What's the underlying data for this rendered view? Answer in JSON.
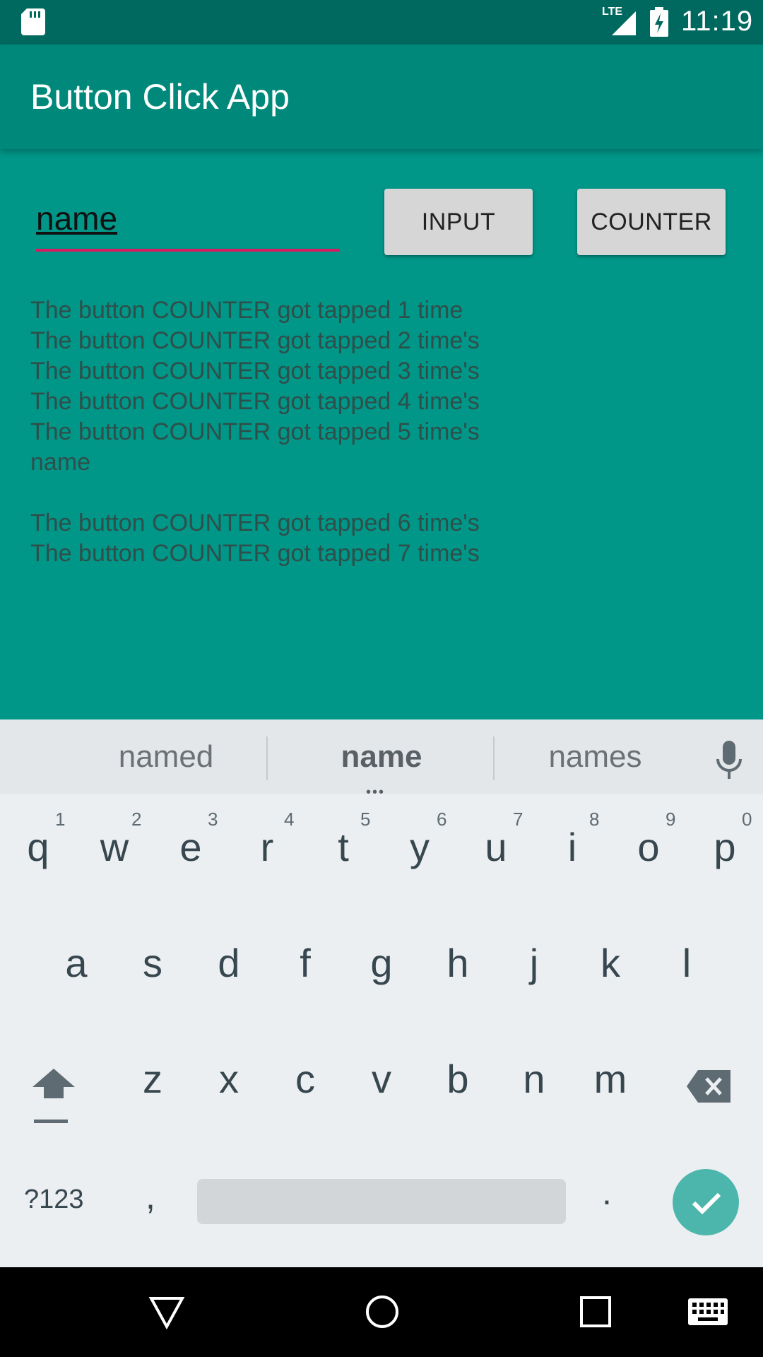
{
  "status_bar": {
    "network": "LTE",
    "time": "11:19"
  },
  "app_bar": {
    "title": "Button Click App"
  },
  "form": {
    "name_value": "name",
    "input_button": "INPUT",
    "counter_button": "COUNTER"
  },
  "log_text": "The button COUNTER got tapped 1 time\nThe button COUNTER got tapped 2 time's\nThe button COUNTER got tapped 3 time's\nThe button COUNTER got tapped 4 time's\nThe button COUNTER got tapped 5 time's\nname\n\nThe button COUNTER got tapped 6 time's\nThe button COUNTER got tapped 7 time's",
  "keyboard": {
    "suggestions": [
      "named",
      "name",
      "names"
    ],
    "row1": [
      "q",
      "w",
      "e",
      "r",
      "t",
      "y",
      "u",
      "i",
      "o",
      "p"
    ],
    "row1_hints": [
      "1",
      "2",
      "3",
      "4",
      "5",
      "6",
      "7",
      "8",
      "9",
      "0"
    ],
    "row2": [
      "a",
      "s",
      "d",
      "f",
      "g",
      "h",
      "j",
      "k",
      "l"
    ],
    "row3": [
      "z",
      "x",
      "c",
      "v",
      "b",
      "n",
      "m"
    ],
    "symbols_label": "?123",
    "comma": ",",
    "period": "."
  },
  "icons": {
    "sd_card": "sd-card-icon",
    "signal": "signal-icon",
    "battery": "battery-charging-icon",
    "mic": "mic-icon",
    "shift": "shift-icon",
    "backspace": "backspace-icon",
    "enter": "checkmark-icon",
    "back": "back-triangle-icon",
    "home": "home-circle-icon",
    "recents": "recents-square-icon",
    "keyboard_switch": "keyboard-icon"
  },
  "colors": {
    "background": "#009688",
    "app_bar": "#00897b",
    "status_bar": "#00695f",
    "input_underline": "#d81b60",
    "enter_key": "#4db6ac"
  }
}
